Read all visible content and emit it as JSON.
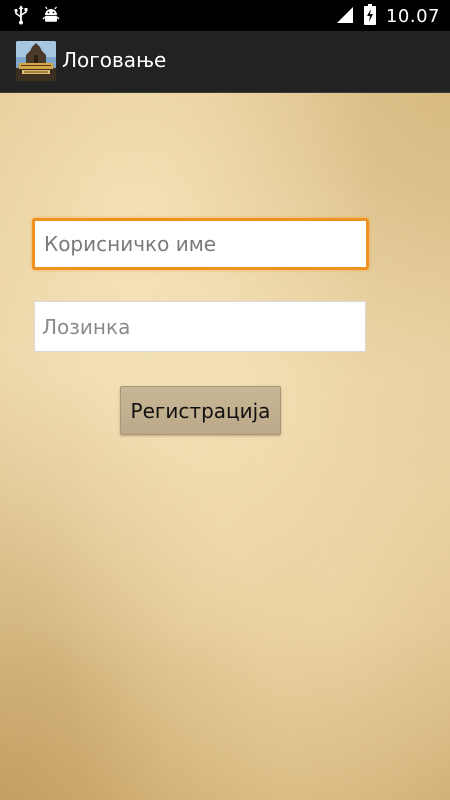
{
  "status_bar": {
    "time": "10.07",
    "left_icons": [
      "usb-icon",
      "android-debug-icon"
    ],
    "right_icons": [
      "signal-icon",
      "battery-charging-icon"
    ]
  },
  "action_bar": {
    "title": "Логовање",
    "app_icon": "app-logo-icon"
  },
  "form": {
    "username_placeholder": "Корисничко име",
    "password_placeholder": "Лозинка",
    "register_label": "Регистрација"
  },
  "colors": {
    "focus_accent": "#f0931e",
    "action_bar_bg": "#222222",
    "status_bar_bg": "#000000",
    "paper_bg": "#e6cf9d"
  }
}
